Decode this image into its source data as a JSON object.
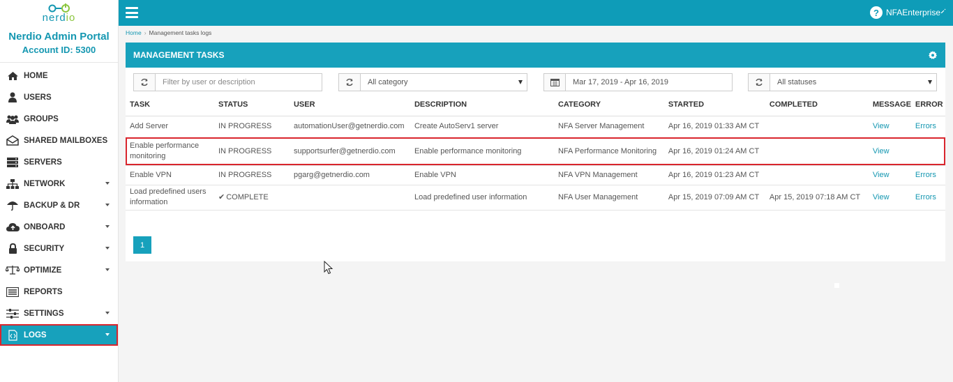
{
  "brand": {
    "logo_text_pre": "nerd",
    "logo_text_post": "io",
    "portal_title": "Nerdio Admin Portal",
    "account_id": "Account ID: 5300"
  },
  "nav": [
    {
      "label": "HOME",
      "icon": "home-icon"
    },
    {
      "label": "USERS",
      "icon": "user-icon"
    },
    {
      "label": "GROUPS",
      "icon": "group-icon"
    },
    {
      "label": "SHARED MAILBOXES",
      "icon": "mailbox-icon"
    },
    {
      "label": "SERVERS",
      "icon": "server-icon"
    },
    {
      "label": "NETWORK",
      "icon": "network-icon"
    },
    {
      "label": "BACKUP & DR",
      "icon": "umbrella-icon"
    },
    {
      "label": "ONBOARD",
      "icon": "cloud-upload-icon"
    },
    {
      "label": "SECURITY",
      "icon": "lock-icon"
    },
    {
      "label": "OPTIMIZE",
      "icon": "balance-icon"
    },
    {
      "label": "REPORTS",
      "icon": "report-icon"
    },
    {
      "label": "SETTINGS",
      "icon": "sliders-icon"
    },
    {
      "label": "LOGS",
      "icon": "code-file-icon"
    }
  ],
  "topbar": {
    "help": "?",
    "user": "NFAEnterprise"
  },
  "breadcrumb": {
    "home": "Home",
    "current": "Management tasks logs"
  },
  "panel": {
    "title": "MANAGEMENT TASKS"
  },
  "filters": {
    "search_placeholder": "Filter by user or description",
    "category": "All category",
    "date_range": "Mar 17, 2019 - Apr 16, 2019",
    "status": "All statuses"
  },
  "table": {
    "headers": {
      "task": "TASK",
      "status": "STATUS",
      "user": "USER",
      "description": "DESCRIPTION",
      "category": "CATEGORY",
      "started": "STARTED",
      "completed": "COMPLETED",
      "message": "MESSAGE",
      "error": "ERROR"
    },
    "rows": [
      {
        "task": "Add Server",
        "status": "IN PROGRESS",
        "user": "automationUser@getnerdio.com",
        "description": "Create AutoServ1 server",
        "category": "NFA Server Management",
        "started": "Apr 16, 2019 01:33 AM CT",
        "completed": "",
        "message": "View",
        "error": "Errors"
      },
      {
        "task": "Enable performance monitoring",
        "status": "IN PROGRESS",
        "user": "supportsurfer@getnerdio.com",
        "description": "Enable performance monitoring",
        "category": "NFA Performance Monitoring",
        "started": "Apr 16, 2019 01:24 AM CT",
        "completed": "",
        "message": "View",
        "error": ""
      },
      {
        "task": "Enable VPN",
        "status": "IN PROGRESS",
        "user": "pgarg@getnerdio.com",
        "description": "Enable VPN",
        "category": "NFA VPN Management",
        "started": "Apr 16, 2019 01:23 AM CT",
        "completed": "",
        "message": "View",
        "error": "Errors"
      },
      {
        "task": "Load predefined users information",
        "status": "COMPLETE",
        "user": "",
        "description": "Load predefined user information",
        "category": "NFA User Management",
        "started": "Apr 15, 2019 07:09 AM CT",
        "completed": "Apr 15, 2019 07:18 AM CT",
        "message": "View",
        "error": "Errors"
      }
    ]
  },
  "pagination": {
    "current_page": "1"
  },
  "colors": {
    "primary": "#0e9cb8",
    "highlight": "#d9252d"
  }
}
